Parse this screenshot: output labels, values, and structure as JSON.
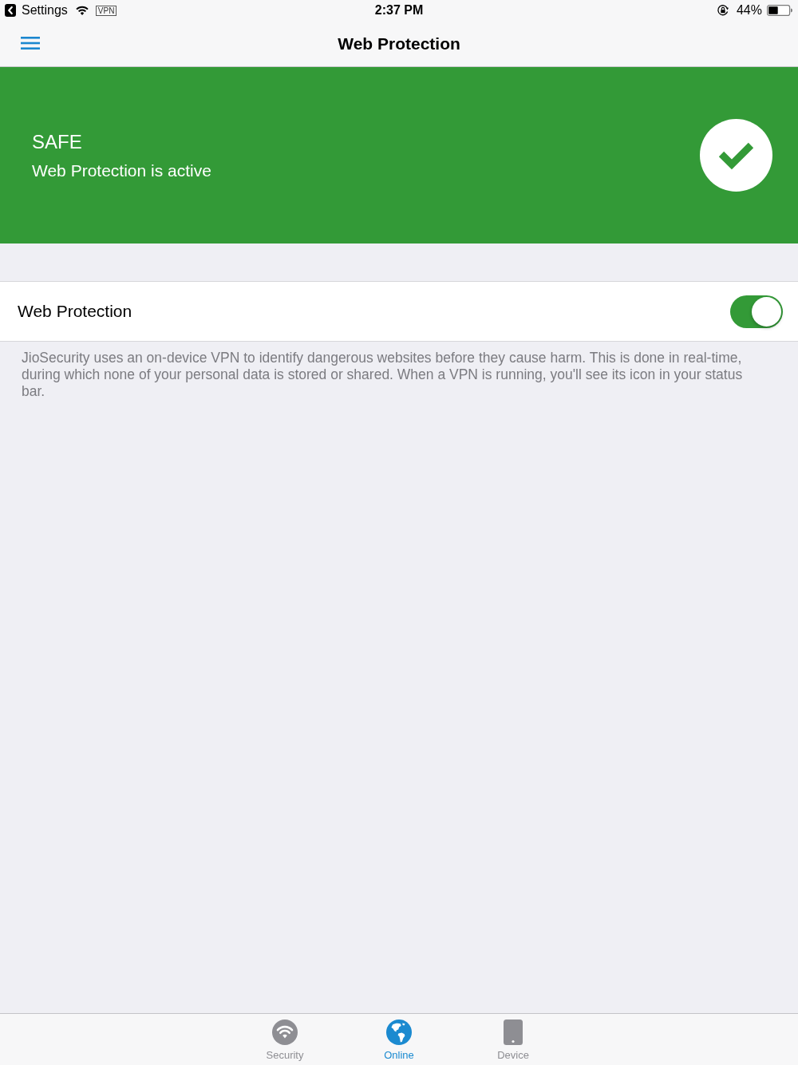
{
  "status_bar": {
    "back_label": "Settings",
    "vpn_badge": "VPN",
    "time": "2:37 PM",
    "battery_text": "44%"
  },
  "nav_bar": {
    "title": "Web Protection"
  },
  "status_banner": {
    "heading": "SAFE",
    "message": "Web Protection is active"
  },
  "settings": [
    {
      "label": "Web Protection",
      "on": true
    }
  ],
  "description": "JioSecurity uses an on-device VPN to identify dangerous websites before they cause harm. This is done in real-time, during which none of your personal data is stored or shared. When a VPN is running, you'll see its icon in your status bar.",
  "tab_bar": {
    "tabs": [
      {
        "label": "Security",
        "selected": false
      },
      {
        "label": "Online",
        "selected": true
      },
      {
        "label": "Device",
        "selected": false
      }
    ]
  }
}
